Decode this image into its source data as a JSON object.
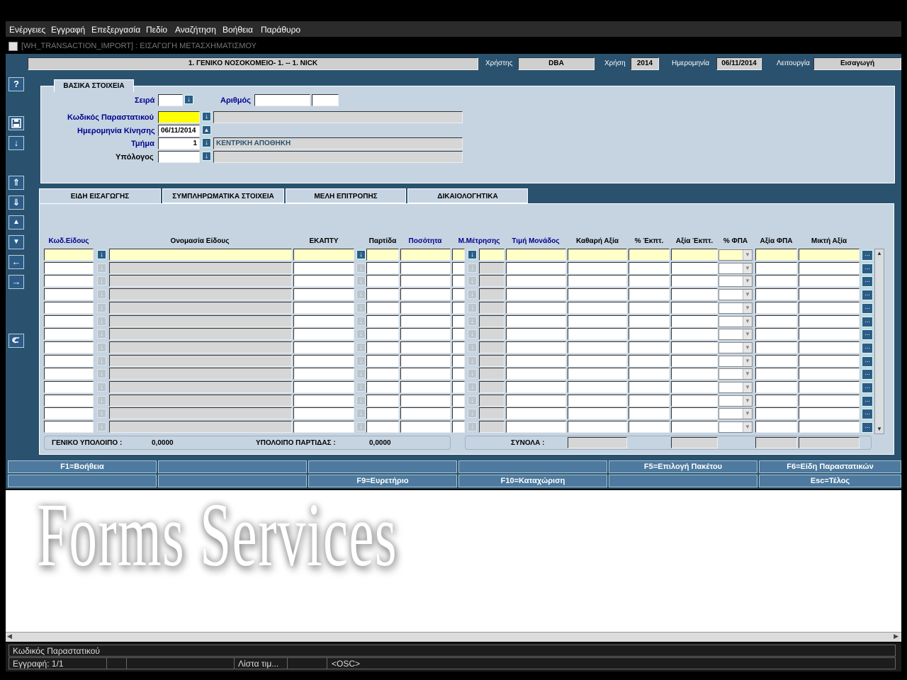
{
  "menu": [
    "Ενέργειες",
    "Εγγραφή",
    "Επεξεργασία",
    "Πεδίο",
    "Αναζήτηση",
    "Βοήθεια",
    "Παράθυρο"
  ],
  "window_title": "[WH_TRANSACTION_IMPORT]  :  ΕΙΣΑΓΩΓΗ ΜΕΤΑΣΧΗΜΑΤΙΣΜΟΥ",
  "header": {
    "company": "1. ΓΕΝΙΚΟ ΝΟΣΟΚΟΜΕΙΟ- 1. -- 1. NICK",
    "user_label": "Χρήστης",
    "user": "DBA",
    "year_label": "Χρήση",
    "year": "2014",
    "date_label": "Ημερομηνία",
    "date": "06/11/2014",
    "function_label": "Λειτουργία",
    "function": "Εισαγωγή"
  },
  "basic": {
    "tab": "ΒΑΣΙΚΑ ΣΤΟΙΧΕΙΑ",
    "series_label": "Σειρά",
    "number_label": "Αριθμός",
    "doc_code_label": "Κωδικός Παραστατικού",
    "move_date_label": "Ημερομηνία Κίνησης",
    "move_date": "06/11/2014",
    "dept_label": "Τμήμα",
    "dept_code": "1",
    "dept_name": "ΚΕΝΤΡΙΚΗ ΑΠΟΘΗΚΗ",
    "accountable_label": "Υπόλογος"
  },
  "tabs": [
    "ΕΙΔΗ ΕΙΣΑΓΩΓΗΣ",
    "ΣΥΜΠΛΗΡΩΜΑΤΙΚΑ ΣΤΟΙΧΕΙΑ",
    "ΜΕΛΗ ΕΠΙΤΡΟΠΗΣ",
    "ΔΙΚΑΙΟΛΟΓΗΤΙΚΑ"
  ],
  "columns": [
    "Κωδ.Είδους",
    "Ονομασία Είδους",
    "ΕΚΑΠΤΥ",
    "Παρτίδα",
    "Ποσότητα",
    "Μ.Μέτρησης",
    "Τιμή Μονάδος",
    "Καθαρή Αξία",
    "% Έκπτ.",
    "Αξία Έκπτ.",
    "% ΦΠΑ",
    "Αξία  ΦΠΑ",
    "Μικτή Αξία"
  ],
  "footer": {
    "general_balance_label": "ΓΕΝΙΚΟ ΥΠΟΛΟΙΠΟ :",
    "general_balance": "0,0000",
    "batch_balance_label": "ΥΠΟΛΟΙΠΟ ΠΑΡΤΙΔΑΣ :",
    "batch_balance": "0,0000",
    "totals_label": "ΣΥΝΟΛΑ :"
  },
  "fkeys_row1": [
    "F1=Βοήθεια",
    "",
    "",
    "",
    "F5=Επιλογή Πακέτου",
    "F6=Είδη Παραστατικών"
  ],
  "fkeys_row2": [
    "",
    "",
    "F9=Ευρετήριο",
    "F10=Καταχώριση",
    "",
    "Esc=Τέλος"
  ],
  "watermark": "Forms Services",
  "status": {
    "field": "Κωδικός Παραστατικού",
    "record": "Εγγραφή: 1/1",
    "list": "Λίστα τιμ...",
    "osc": "<OSC>"
  },
  "icons": {
    "help": "?",
    "save": "save-icon",
    "down": "↓",
    "up_first": "⇑",
    "down_last": "⇓",
    "prev_block": "▲",
    "next_block": "▼",
    "prev": "←",
    "next": "→",
    "undo": "undo-icon"
  },
  "colors": {
    "bg": "#2a526e",
    "panel": "#c6d4e2",
    "button": "#2d5c87",
    "required": "#ffff00"
  }
}
